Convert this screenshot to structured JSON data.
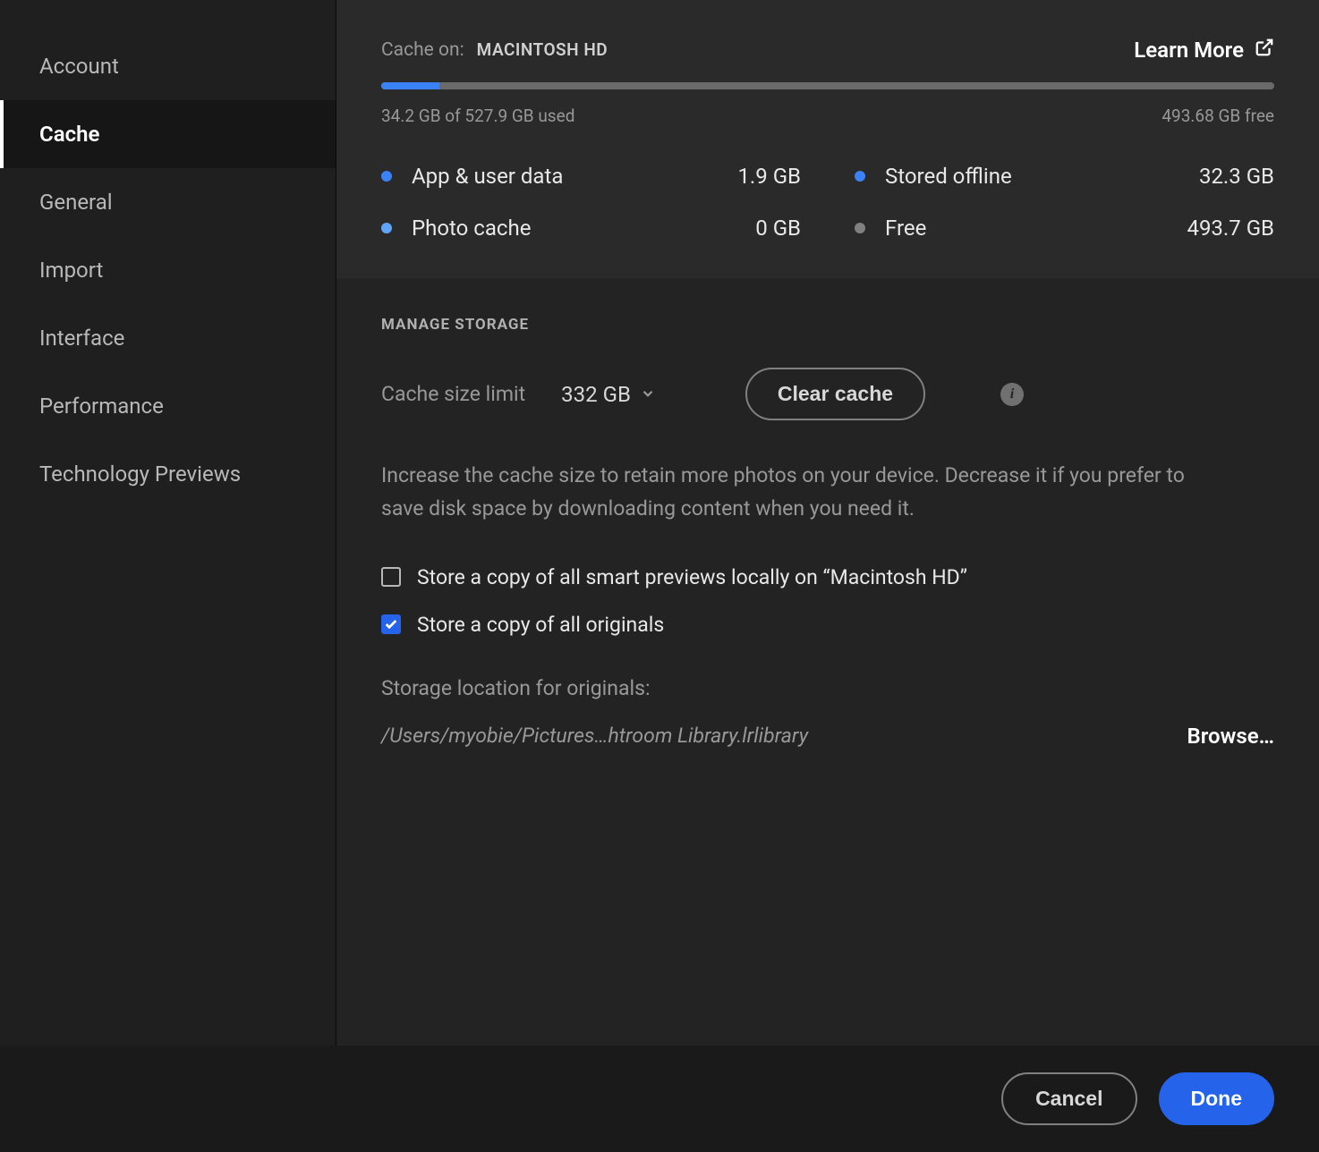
{
  "sidebar": {
    "items": [
      {
        "label": "Account",
        "active": false
      },
      {
        "label": "Cache",
        "active": true
      },
      {
        "label": "General",
        "active": false
      },
      {
        "label": "Import",
        "active": false
      },
      {
        "label": "Interface",
        "active": false
      },
      {
        "label": "Performance",
        "active": false
      },
      {
        "label": "Technology Previews",
        "active": false
      }
    ]
  },
  "header": {
    "cache_on_label": "Cache on:",
    "cache_on_value": "MACINTOSH HD",
    "learn_more": "Learn More"
  },
  "storage": {
    "used_text": "34.2 GB of 527.9 GB used",
    "free_text": "493.68 GB free",
    "progress_percent": 6.5,
    "items": [
      {
        "label": "App & user data",
        "value": "1.9 GB",
        "color": "blue"
      },
      {
        "label": "Stored offline",
        "value": "32.3 GB",
        "color": "blue"
      },
      {
        "label": "Photo cache",
        "value": "0 GB",
        "color": "lightblue"
      },
      {
        "label": "Free",
        "value": "493.7 GB",
        "color": "gray"
      }
    ]
  },
  "manage": {
    "heading": "MANAGE STORAGE",
    "cache_limit_label": "Cache size limit",
    "cache_limit_value": "332 GB",
    "clear_cache_button": "Clear cache",
    "description": "Increase the cache size to retain more photos on your device. Decrease it if you prefer to save disk space by downloading content when you need it.",
    "checkboxes": [
      {
        "label": "Store a copy of all smart previews locally on “Macintosh HD”",
        "checked": false
      },
      {
        "label": "Store a copy of all originals",
        "checked": true
      }
    ],
    "storage_location_label": "Storage location for originals:",
    "storage_path": "/Users/myobie/Pictures…htroom Library.lrlibrary",
    "browse_button": "Browse…"
  },
  "footer": {
    "cancel": "Cancel",
    "done": "Done"
  }
}
